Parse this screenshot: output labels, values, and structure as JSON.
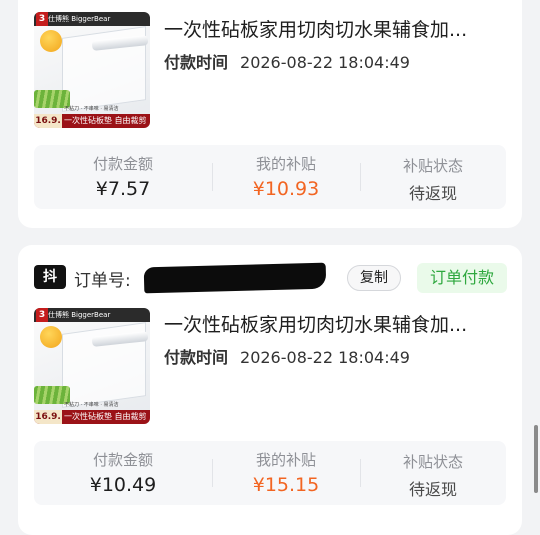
{
  "orders": [
    {
      "product_title": "一次性砧板家用切肉切水果辅食加...",
      "pay_time_label": "付款时间",
      "pay_time": "2026-08-22 18:04:49",
      "thumb": {
        "badge": "3",
        "brand": "仕博熊 BiggerBear",
        "price_tag": "16.9.",
        "caption": "一次性砧板垫 自由裁剪",
        "strip": "不粘刀 · 不串味 · 易清洁"
      },
      "stats": {
        "amount_label": "付款金额",
        "amount": "¥7.57",
        "subsidy_label": "我的补贴",
        "subsidy": "¥10.93",
        "status_label": "补贴状态",
        "status": "待返现"
      }
    },
    {
      "platform_icon": "抖",
      "order_no_label": "订单号:",
      "copy_label": "复制",
      "order_status": "订单付款",
      "product_title": "一次性砧板家用切肉切水果辅食加...",
      "pay_time_label": "付款时间",
      "pay_time": "2026-08-22 18:04:49",
      "thumb": {
        "badge": "3",
        "brand": "仕博熊 BiggerBear",
        "price_tag": "16.9.",
        "caption": "一次性砧板垫 自由裁剪",
        "strip": "不粘刀 · 不串味 · 易清洁"
      },
      "stats": {
        "amount_label": "付款金额",
        "amount": "¥10.49",
        "subsidy_label": "我的补贴",
        "subsidy": "¥15.15",
        "status_label": "补贴状态",
        "status": "待返现"
      }
    }
  ],
  "colors": {
    "subsidy": "#f26522",
    "order_status_text": "#2fa83f",
    "order_status_bg": "#eafaea"
  }
}
